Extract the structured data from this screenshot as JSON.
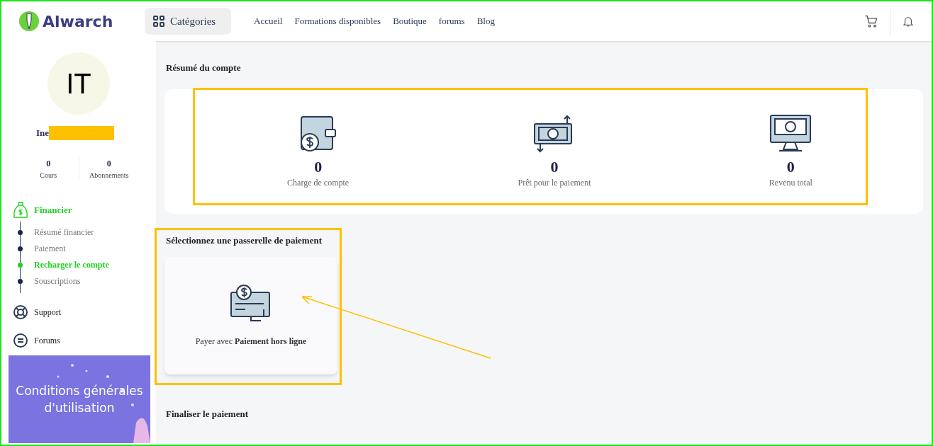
{
  "header": {
    "logo": "Alwarch",
    "categories_button": "Catégories",
    "nav": [
      "Accueil",
      "Formations disponibles",
      "Boutique",
      "forums",
      "Blog"
    ]
  },
  "profile": {
    "initials": "IT",
    "name": "Ine",
    "stats": [
      {
        "value": "0",
        "label": "Cours"
      },
      {
        "value": "0",
        "label": "Abonnements"
      }
    ]
  },
  "sidebar": {
    "section": "Financier",
    "items": [
      {
        "label": "Résumé financier",
        "selected": false
      },
      {
        "label": "Paiement",
        "selected": false
      },
      {
        "label": "Recharger le compte",
        "selected": true
      },
      {
        "label": "Souscriptions",
        "selected": false
      }
    ],
    "links": [
      {
        "label": "Support",
        "kind": "support"
      },
      {
        "label": "Forums",
        "kind": "forums"
      }
    ]
  },
  "banner": {
    "text": "Conditions générales d'utilisation"
  },
  "summary": {
    "title": "Résumé du compte",
    "cards": [
      {
        "kind": "wallet",
        "value": "0",
        "label": "Charge de compte"
      },
      {
        "kind": "transfer",
        "value": "0",
        "label": "Prêt pour le paiement"
      },
      {
        "kind": "monitor",
        "value": "0",
        "label": "Revenu total"
      }
    ]
  },
  "gateway": {
    "title": "Sélectionnez une passerelle de paiement",
    "option": "Payer avec **Paiement hors ligne**"
  },
  "finalize": {
    "title": "Finaliser le paiement"
  }
}
